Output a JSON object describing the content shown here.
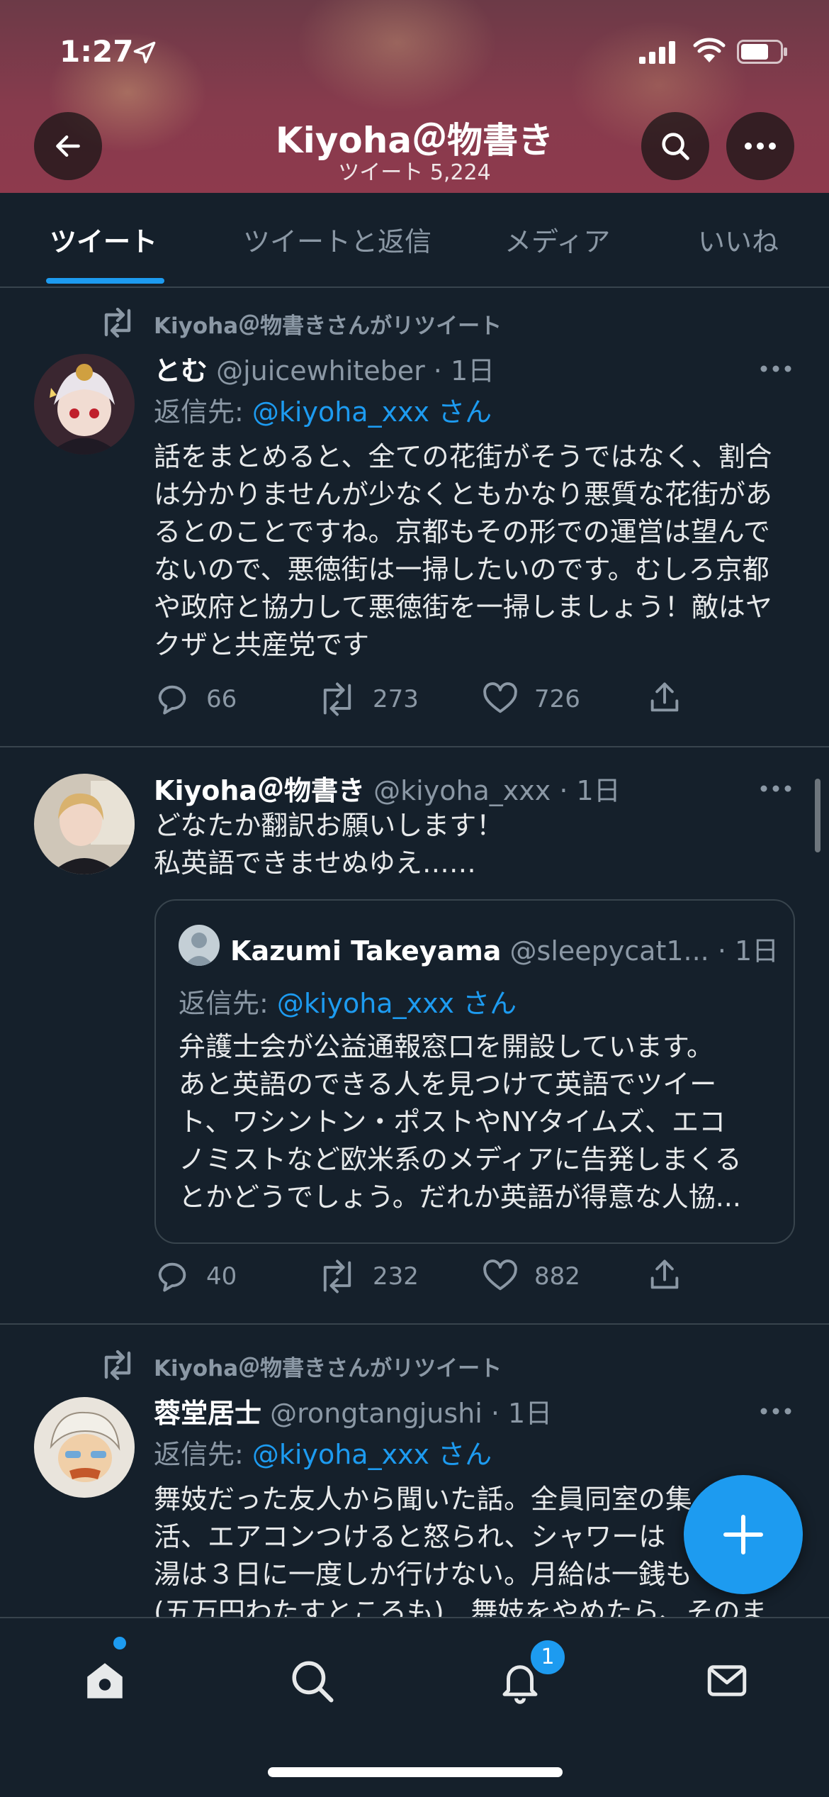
{
  "status_bar": {
    "time": "1:27"
  },
  "header": {
    "profile_name": "Kiyoha＠物書き",
    "tweet_count": "ツイート 5,224"
  },
  "tabs": [
    {
      "label": "ツイート",
      "active": true
    },
    {
      "label": "ツイートと返信"
    },
    {
      "label": "メディア"
    },
    {
      "label": "いいね"
    }
  ],
  "tweets": [
    {
      "retweeted_by": "Kiyoha＠物書きさんがリツイート",
      "display_name": "とむ",
      "handle_time": "@juicewhiteber · 1日",
      "reply_to_label": "返信先:",
      "reply_to_handle": "@kiyoha_xxx さん",
      "text_lines": [
        "話をまとめると、全ての花街がそうではなく、割合",
        "は分かりませんが少なくともかなり悪質な花街があ",
        "るとのことですね。京都もその形での運営は望んで",
        "ないので、悪徳街は一掃したいのです。むしろ京都",
        "や政府と協力して悪徳街を一掃しましょう！敵はヤ",
        "クザと共産党です"
      ],
      "replies": "66",
      "retweets": "273",
      "likes": "726"
    },
    {
      "display_name": "Kiyoha＠物書き",
      "handle_time": "@kiyoha_xxx · 1日",
      "text_lines": [
        "どなたか翻訳お願いします！",
        "私英語できませぬゆえ……"
      ],
      "quote": {
        "display_name": "Kazumi Takeyama",
        "handle_time": "@sleepycat1... · 1日",
        "reply_to_label": "返信先:",
        "reply_to_handle": "@kiyoha_xxx さん",
        "text_lines": [
          "弁護士会が公益通報窓口を開設しています。",
          "あと英語のできる人を見つけて英語でツイー",
          "ト、ワシントン・ポストやNYタイムズ、エコ",
          "ノミストなど欧米系のメディアに告発しまくる",
          "とかどうでしょう。だれか英語が得意な人協..."
        ]
      },
      "replies": "40",
      "retweets": "232",
      "likes": "882"
    },
    {
      "retweeted_by": "Kiyoha＠物書きさんがリツイート",
      "display_name": "蓉堂居士",
      "handle_time": "@rongtangjushi · 1日",
      "reply_to_label": "返信先:",
      "reply_to_handle": "@kiyoha_xxx さん",
      "text_lines": [
        "舞妓だった友人から聞いた話。全員同室の集",
        "活、エアコンつけると怒られ、シャワーは",
        "湯は３日に一度しか行けない。月給は一銭も",
        "(五万円わたすところも)　舞妓をやめたら、そのま"
      ]
    }
  ],
  "bottom_nav": {
    "notification_count": "1"
  },
  "colors": {
    "accent": "#1d9bf0",
    "background": "#15202b",
    "divider": "#38444d"
  }
}
